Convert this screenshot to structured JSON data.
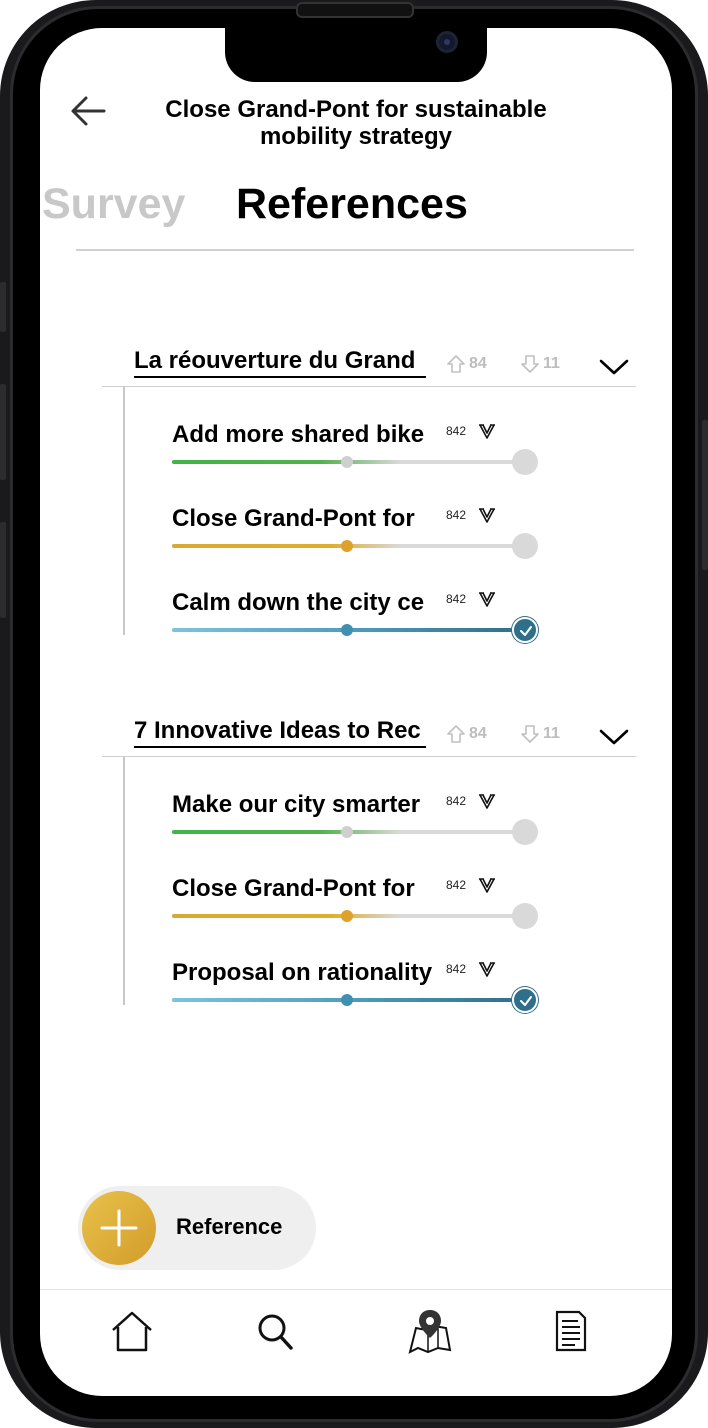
{
  "header": {
    "title": "Close Grand-Pont for sustainable mobility strategy",
    "back_icon": "arrow-left-icon"
  },
  "tabs": [
    {
      "label": "Survey",
      "active": false
    },
    {
      "label": "References",
      "active": true
    }
  ],
  "groups": [
    {
      "title": "La réouverture du Grand",
      "upvotes": "84",
      "downvotes": "11",
      "items": [
        {
          "title": "Add more shared bike",
          "count": "842",
          "progress": 0.5,
          "color": "green",
          "selected": false
        },
        {
          "title": "Close Grand-Pont for",
          "count": "842",
          "progress": 0.5,
          "color": "gold",
          "selected": false
        },
        {
          "title": "Calm down the city ce",
          "count": "842",
          "progress": 1.0,
          "color": "blue",
          "selected": true
        }
      ]
    },
    {
      "title": "7 Innovative Ideas to Rec",
      "upvotes": "84",
      "downvotes": "11",
      "items": [
        {
          "title": "Make our city smarter",
          "count": "842",
          "progress": 0.5,
          "color": "green",
          "selected": false
        },
        {
          "title": "Close Grand-Pont for",
          "count": "842",
          "progress": 0.5,
          "color": "gold",
          "selected": false
        },
        {
          "title": "Proposal on rationality",
          "count": "842",
          "progress": 1.0,
          "color": "blue",
          "selected": true
        }
      ]
    }
  ],
  "fab": {
    "label": "Reference",
    "icon": "plus-icon",
    "color": "#dcae3a"
  },
  "bottom_nav": [
    {
      "name": "home",
      "icon": "home-icon"
    },
    {
      "name": "search",
      "icon": "search-icon"
    },
    {
      "name": "map",
      "icon": "map-pin-icon"
    },
    {
      "name": "documents",
      "icon": "document-icon"
    }
  ],
  "colors": {
    "green": "#52b14e",
    "gold": "#dea12b",
    "blue": "#2f6f89",
    "inactive_tab": "#c8c8c8"
  }
}
